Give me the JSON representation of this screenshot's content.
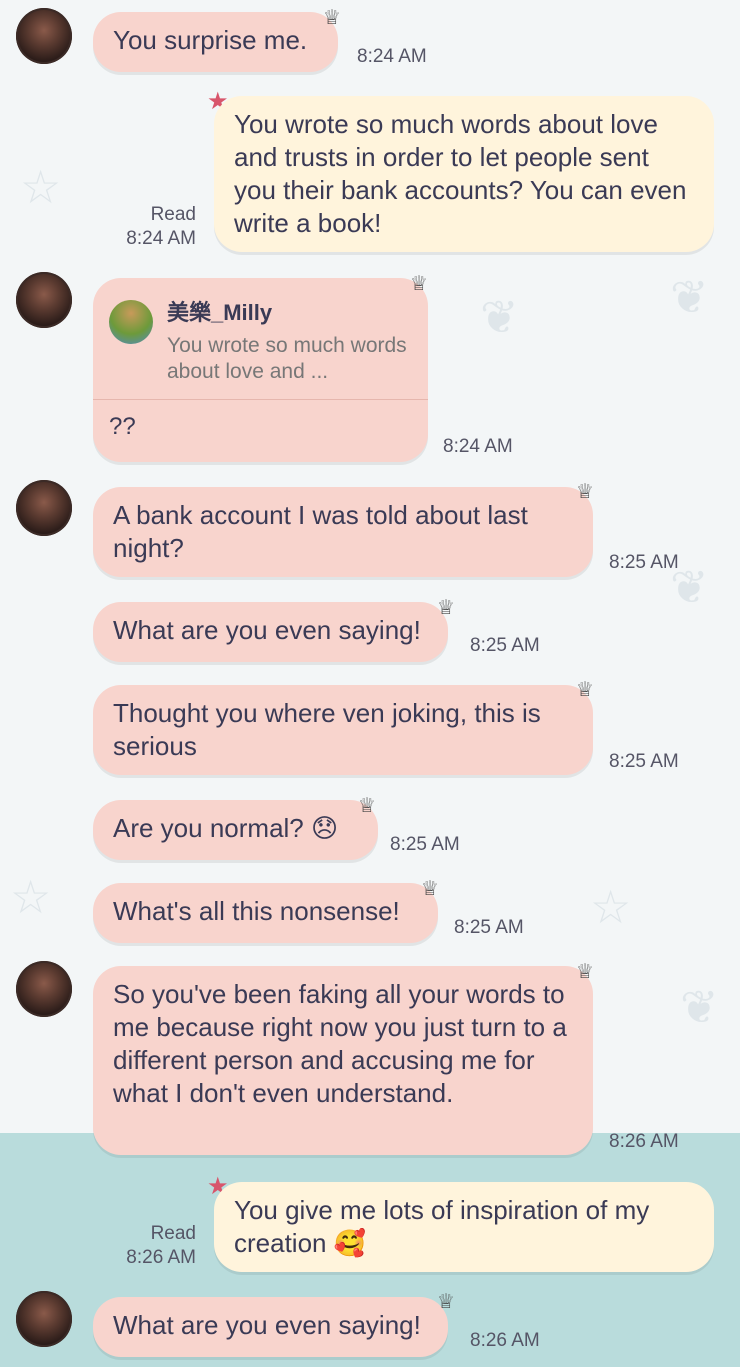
{
  "messages": {
    "m1": {
      "text": "You surprise me.",
      "time": "8:24 AM"
    },
    "m2": {
      "text": "You wrote so much words about love and trusts in order to let people sent you their bank accounts? You can even write a book!",
      "status": "Read",
      "time": "8:24 AM"
    },
    "m3": {
      "reply_name": "美樂_Milly",
      "reply_snippet": "You wrote so much words about love and ...",
      "text": "??",
      "time": "8:24 AM"
    },
    "m4": {
      "text": "A bank account I was told about last night?",
      "time": "8:25 AM"
    },
    "m5": {
      "text": "What are you even saying!",
      "time": "8:25 AM"
    },
    "m6": {
      "text": "Thought you where ven joking, this is serious",
      "time": "8:25 AM"
    },
    "m7": {
      "text": "Are you normal?",
      "emoji": "😞",
      "time": "8:25 AM"
    },
    "m8": {
      "text": "What's all this nonsense!",
      "time": "8:25 AM"
    },
    "m9": {
      "text": "So you've been faking all your words to me because right now you just turn to a different person and accusing me for what I don't even understand.",
      "time": "8:26 AM"
    },
    "m10": {
      "text": "You give me lots of inspiration of my creation",
      "emoji": "🥰",
      "status": "Read",
      "time": "8:26 AM"
    },
    "m11": {
      "text": "What are you even saying!",
      "time": "8:26 AM"
    }
  },
  "icons": {
    "avatar": "contact-avatar-icon",
    "in_bubble_decoration": "shell-icon",
    "out_bubble_decoration": "starfish-icon",
    "reply_thumbnail": "reply-avatar-icon"
  },
  "colors": {
    "incoming_bubble": "#f8d4cd",
    "outgoing_bubble": "#fff4dc",
    "background": "#f3f6f7",
    "bottom_background": "#b9dcdc",
    "star_accent": "#d8556b"
  }
}
